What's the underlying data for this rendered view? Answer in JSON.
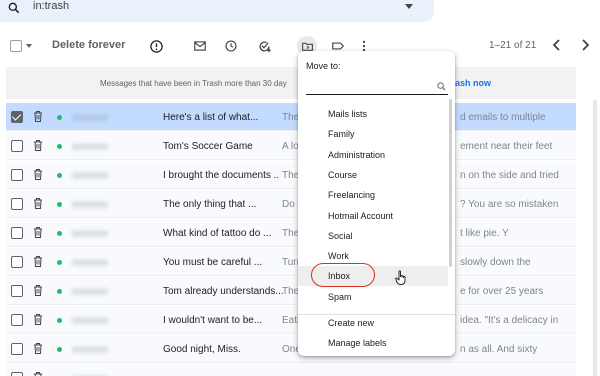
{
  "search": {
    "query": "in:trash"
  },
  "toolbar": {
    "delete_forever": "Delete forever",
    "pager_text": "1–21 of 21",
    "icons": [
      "select-all-checkbox",
      "report-spam-icon",
      "mark-unread-icon",
      "snooze-icon",
      "add-to-tasks-icon",
      "move-to-icon",
      "label-icon",
      "more-icon"
    ]
  },
  "banner": {
    "message": "Messages that have been in Trash more than 30 day",
    "link": "ash now"
  },
  "rows": [
    {
      "selected": true,
      "subject": "Here's a list of what...",
      "snippet": "The C",
      "snippet_right": "d emails to multiple"
    },
    {
      "selected": false,
      "subject": "Tom's Soccer Game",
      "snippet": "A lon",
      "snippet_right": "ement near their feet"
    },
    {
      "selected": false,
      "subject": "I brought the documents ..",
      "snippet": "The c",
      "snippet_right": "n on the side and tried"
    },
    {
      "selected": false,
      "subject": "The only thing that ...",
      "snippet": "Do yo",
      "snippet_right": "? You are so mistaken"
    },
    {
      "selected": false,
      "subject": "What kind of tattoo do ...",
      "snippet": "The c",
      "snippet_right": "t like pie. Y"
    },
    {
      "selected": false,
      "subject": "You must be careful ...",
      "snippet": "Turn",
      "snippet_right": "slowly down the"
    },
    {
      "selected": false,
      "subject": "Tom already understands...",
      "snippet": "The c",
      "snippet_right": "e for over 25 years"
    },
    {
      "selected": false,
      "subject": "I wouldn't want to be...",
      "snippet": "Eatin",
      "snippet_right": "idea. \"It's a delicacy in"
    },
    {
      "selected": false,
      "subject": "Good night, Miss.",
      "snippet": "One",
      "snippet_right": "n as all. And sixty"
    },
    {
      "selected": false,
      "subject": "",
      "snippet": "",
      "snippet_right": ""
    }
  ],
  "move_popup": {
    "title": "Move to:",
    "filter_value": "",
    "options": [
      "Mails lists",
      "Family",
      "Administration",
      "Course",
      "Freelancing",
      "Hotmail Account",
      "Social",
      "Work",
      "Inbox",
      "Spam"
    ],
    "hovered": "Inbox",
    "actions": {
      "create_new": "Create new",
      "manage_labels": "Manage labels"
    }
  },
  "colors": {
    "accent_blue": "#1a73e8",
    "selected_row": "#c2dbff",
    "unread_dot": "#1fbd6e",
    "annotation_red": "#d93025"
  }
}
